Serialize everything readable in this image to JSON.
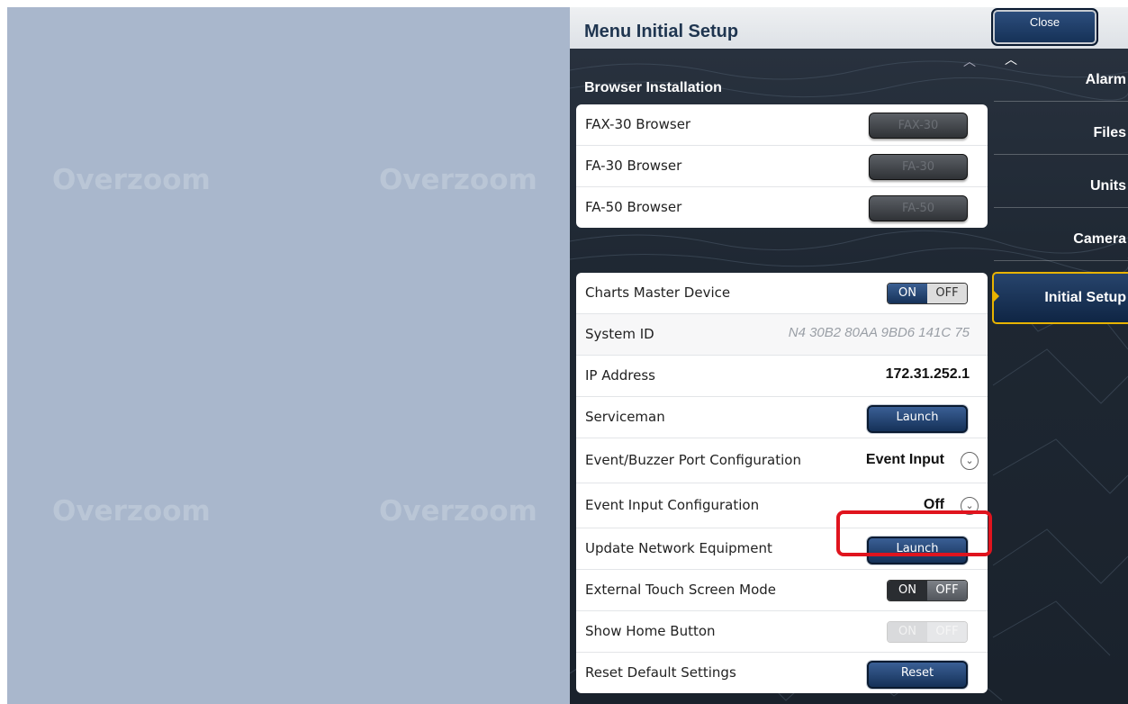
{
  "watermarks": [
    "Overzoom",
    "Overzoom",
    "Overzoom",
    "Overzoom"
  ],
  "header": {
    "title": "Menu Initial Setup",
    "close_label": "Close"
  },
  "browser_section": {
    "title": "Browser Installation",
    "rows": [
      {
        "label": "FAX-30 Browser",
        "button": "FAX-30"
      },
      {
        "label": "FA-30 Browser",
        "button": "FA-30"
      },
      {
        "label": "FA-50 Browser",
        "button": "FA-50"
      }
    ]
  },
  "settings": {
    "charts_master": {
      "label": "Charts Master Device",
      "on": "ON",
      "off": "OFF",
      "state": "ON"
    },
    "system_id": {
      "label": "System ID",
      "value": "N4 30B2 80AA 9BD6 141C 75"
    },
    "ip": {
      "label": "IP Address",
      "value": "172.31.252.1"
    },
    "serviceman": {
      "label": "Serviceman",
      "button": "Launch"
    },
    "event_buzzer": {
      "label": "Event/Buzzer Port Configuration",
      "value": "Event Input"
    },
    "event_input": {
      "label": "Event Input Configuration",
      "value": "Off"
    },
    "update_network": {
      "label": "Update Network Equipment",
      "button": "Launch"
    },
    "external_touch": {
      "label": "External Touch Screen Mode",
      "on": "ON",
      "off": "OFF",
      "state": "OFF"
    },
    "show_home": {
      "label": "Show Home Button",
      "on": "ON",
      "off": "OFF",
      "state": "disabled"
    },
    "reset": {
      "label": "Reset Default Settings",
      "button": "Reset"
    }
  },
  "nav": {
    "items": [
      "Alarm",
      "Files",
      "Units",
      "Camera",
      "Initial Setup"
    ],
    "active": "Initial Setup"
  },
  "colors": {
    "accent": "#e8b300",
    "highlight": "#e0141e",
    "primary_button": "#153158"
  }
}
